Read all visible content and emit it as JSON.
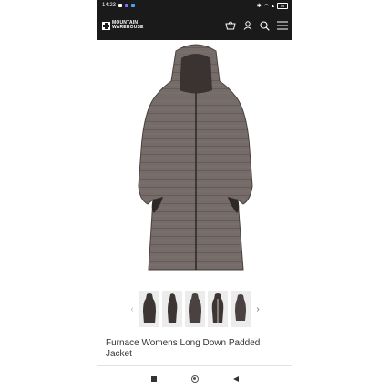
{
  "status_bar": {
    "time": "14:23",
    "left_more": "···",
    "battery_level": "59"
  },
  "header": {
    "brand_line1": "MOUNTAIN",
    "brand_line2": "WAREHOUSE",
    "icons": [
      "basket-icon",
      "account-icon",
      "search-icon",
      "menu-icon"
    ]
  },
  "product": {
    "name": "Furnace Womens Long Down Padded Jacket",
    "jacket_color": "#756b68",
    "thumbnail_count": 5
  },
  "thumbnails": {
    "prev": "‹",
    "next": "›"
  },
  "colors": {
    "header_bg": "#1a1a1a",
    "page_bg": "#ffffff",
    "text": "#333333"
  }
}
